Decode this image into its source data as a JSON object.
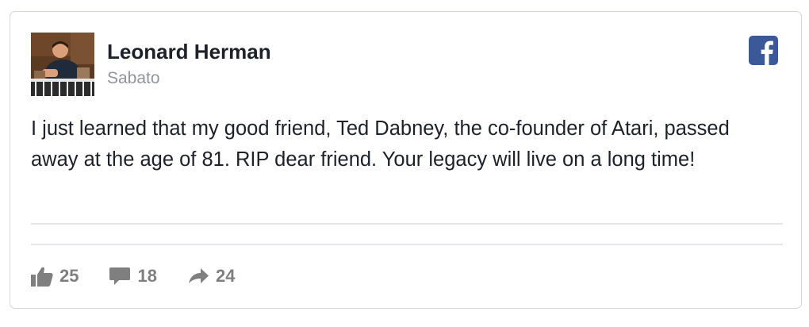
{
  "post": {
    "author": "Leonard Herman",
    "date": "Sabato",
    "text": "I just learned that my good friend, Ted Dabney, the co-founder of Atari, passed away at the age of 81. RIP dear friend. Your legacy will live on a long time!",
    "platform_icon": "facebook-icon",
    "brand_color": "#3b5998"
  },
  "stats": {
    "likes": "25",
    "comments": "18",
    "shares": "24",
    "icons": [
      "like-icon",
      "comment-icon",
      "share-icon"
    ],
    "icon_color": "#7f7f7f"
  }
}
